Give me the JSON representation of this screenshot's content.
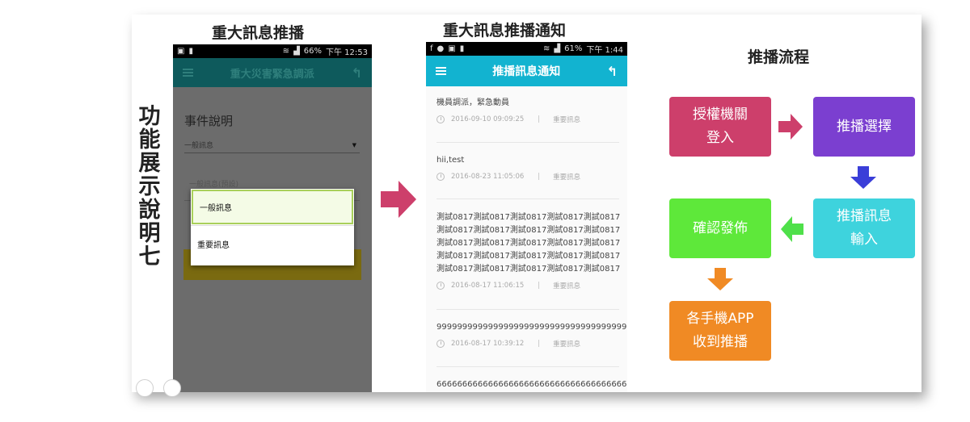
{
  "vertical_title": "功能展示說明七",
  "section_titles": {
    "push": "重大訊息推播",
    "notify": "重大訊息推播通知",
    "flow": "推播流程"
  },
  "phone1": {
    "status_battery": "66%",
    "status_time": "下午 12:53",
    "app_title": "重大災害緊急調派",
    "event_label": "事件說明",
    "select_value": "一般訊息",
    "ghost_text": "一般訊息(預設)",
    "dialog_options": [
      "一般訊息",
      "重要訊息"
    ]
  },
  "phone2": {
    "status_battery": "61%",
    "status_time": "下午 1:44",
    "app_title": "推播訊息通知",
    "messages": [
      {
        "body": [
          "機員調派，緊急動員"
        ],
        "time": "2016-09-10 09:09:25",
        "tag": "重要訊息"
      },
      {
        "body": [
          "hii,test"
        ],
        "time": "2016-08-23 11:05:06",
        "tag": "重要訊息"
      },
      {
        "body": [
          "測試0817測試0817測試0817測試0817測試0817",
          "測試0817測試0817測試0817測試0817測試0817",
          "測試0817測試0817測試0817測試0817測試0817",
          "測試0817測試0817測試0817測試0817測試0817",
          "測試0817測試0817測試0817測試0817測試0817"
        ],
        "time": "2016-08-17 11:06:15",
        "tag": "重要訊息"
      },
      {
        "body": [
          "99999999999999999999999999999999999999999"
        ],
        "time": "2016-08-17 10:39:12",
        "tag": "重要訊息"
      },
      {
        "body": [
          "66666666666666666666666666666666666666666"
        ],
        "time": "",
        "tag": ""
      }
    ]
  },
  "flow": {
    "login": [
      "授權機關",
      "登入"
    ],
    "select": [
      "推播選擇"
    ],
    "input": [
      "推播訊息",
      "輸入"
    ],
    "confirm": [
      "確認發佈"
    ],
    "receive": [
      "各手機APP",
      "收到推播"
    ]
  },
  "colors": {
    "login": "#cd3f6b",
    "select": "#7b3fd0",
    "input": "#3ed3dd",
    "confirm": "#5ee83a",
    "receive": "#f08a24",
    "arrow_right": "#cd3f6b",
    "arrow_down_blue": "#3a3ed8",
    "arrow_left_green": "#4fe04a",
    "arrow_down_orange": "#f08a24",
    "phone2_bar": "#12b3d0"
  }
}
